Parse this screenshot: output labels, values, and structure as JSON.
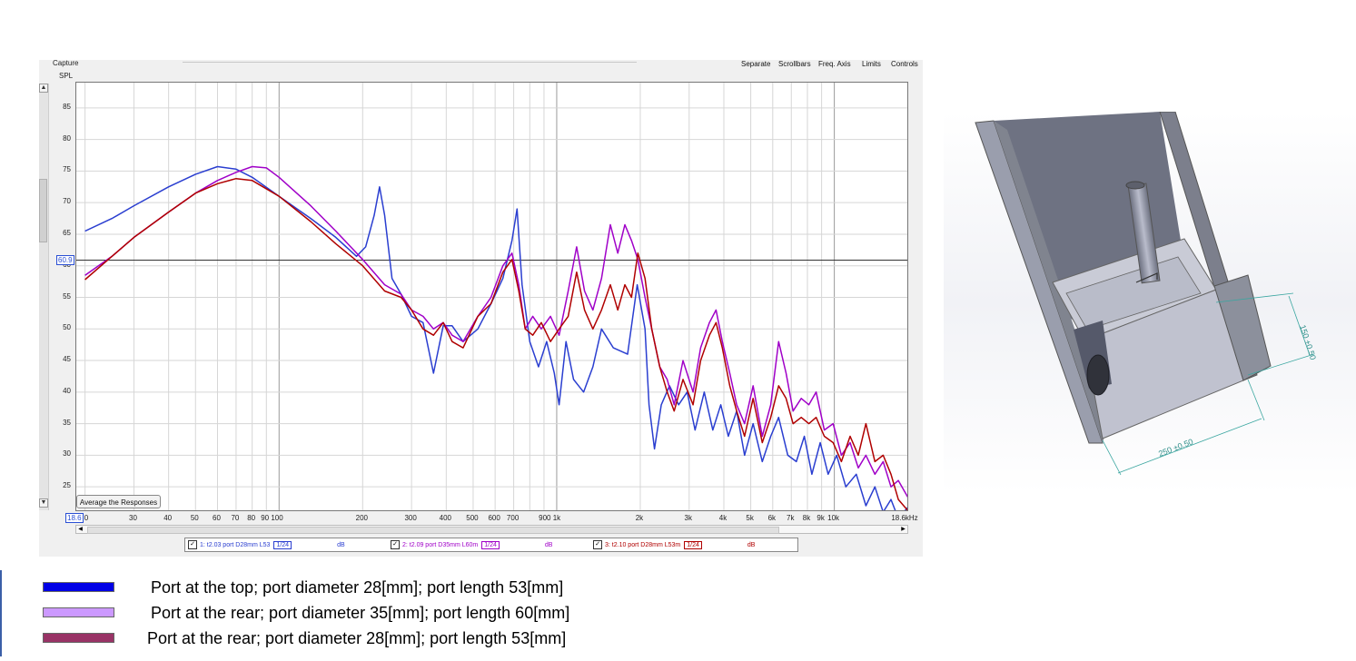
{
  "rew": {
    "capture_label": "Capture",
    "spl_label": "SPL",
    "menu": [
      "Separate",
      "Scrollbars",
      "Freq. Axis",
      "Limits",
      "Controls"
    ],
    "cursor_value": "60.9",
    "start_freq_box": "18.6",
    "x_end_label": "18.6kHz",
    "average_button": "Average the Responses",
    "scroll_up_glyph": "▲",
    "scroll_down_glyph": "▼",
    "scroll_left_glyph": "◀",
    "scroll_right_glyph": "▶",
    "traces": [
      {
        "check": "✓",
        "name": "1: t2.03 port D28mm L53",
        "smoothing": "1/24",
        "unit": "dB",
        "color": "#2a3ed0"
      },
      {
        "check": "✓",
        "name": "2: t2.09 port D35mm L60m",
        "smoothing": "1/24",
        "unit": "dB",
        "color": "#a000c8"
      },
      {
        "check": "✓",
        "name": "3: t2.10 port D28mm L53m",
        "smoothing": "1/24",
        "unit": "dB",
        "color": "#b00000"
      }
    ]
  },
  "legend": [
    {
      "label": "Port at the top; port diameter 28[mm]; port length 53[mm]",
      "color": "#0000e6"
    },
    {
      "label": "Port at the rear; port diameter 35[mm]; port length 60[mm]",
      "color": "#cc99ff"
    },
    {
      "label": "Port at the rear; port diameter 28[mm]; port length 53[mm]",
      "color": "#993366"
    }
  ],
  "cad": {
    "dim_height": "150 ±0.50",
    "dim_width": "250 ±0.50"
  },
  "chart_data": {
    "type": "line",
    "title": "",
    "xlabel": "",
    "ylabel": "SPL",
    "x_scale": "log",
    "xlim": [
      18.6,
      18600
    ],
    "ylim": [
      21,
      89
    ],
    "x_tick_labels": [
      "0",
      "30",
      "40",
      "50",
      "60",
      "70",
      "80",
      "90 100",
      "200",
      "300",
      "400",
      "500",
      "600",
      "700",
      "900 1k",
      "2k",
      "3k",
      "4k",
      "5k",
      "6k",
      "7k",
      "8k",
      "9k",
      "10k"
    ],
    "x_tick_values": [
      18.6,
      30,
      40,
      50,
      60,
      70,
      80,
      95,
      200,
      300,
      400,
      500,
      600,
      700,
      950,
      2000,
      3000,
      4000,
      5000,
      6000,
      7000,
      8000,
      9000,
      10000
    ],
    "y_ticks": [
      25,
      30,
      35,
      40,
      45,
      50,
      55,
      60,
      65,
      70,
      75,
      80,
      85
    ],
    "cursor_line_y": 60.9,
    "grid": true,
    "series": [
      {
        "name": "1: t2.03 port D28mm L53",
        "color": "#2a3ed0",
        "points": [
          [
            20,
            65.5
          ],
          [
            25,
            67.5
          ],
          [
            30,
            69.5
          ],
          [
            40,
            72.5
          ],
          [
            50,
            74.5
          ],
          [
            60,
            75.7
          ],
          [
            70,
            75.3
          ],
          [
            80,
            74
          ],
          [
            100,
            71
          ],
          [
            130,
            67.5
          ],
          [
            160,
            64.5
          ],
          [
            190,
            61.5
          ],
          [
            205,
            63
          ],
          [
            220,
            68
          ],
          [
            230,
            72.5
          ],
          [
            240,
            68
          ],
          [
            255,
            58
          ],
          [
            275,
            55.5
          ],
          [
            300,
            52
          ],
          [
            330,
            51
          ],
          [
            360,
            43
          ],
          [
            390,
            50.5
          ],
          [
            420,
            50.5
          ],
          [
            460,
            48
          ],
          [
            520,
            50
          ],
          [
            580,
            54
          ],
          [
            640,
            58
          ],
          [
            690,
            64
          ],
          [
            720,
            69
          ],
          [
            750,
            57
          ],
          [
            800,
            48
          ],
          [
            860,
            44
          ],
          [
            920,
            48
          ],
          [
            980,
            43
          ],
          [
            1020,
            38
          ],
          [
            1080,
            48
          ],
          [
            1150,
            42
          ],
          [
            1250,
            40
          ],
          [
            1350,
            44
          ],
          [
            1450,
            50
          ],
          [
            1600,
            47
          ],
          [
            1800,
            46
          ],
          [
            1950,
            57
          ],
          [
            2080,
            50
          ],
          [
            2150,
            38
          ],
          [
            2250,
            31
          ],
          [
            2380,
            38
          ],
          [
            2550,
            41
          ],
          [
            2750,
            38
          ],
          [
            2950,
            40
          ],
          [
            3150,
            34
          ],
          [
            3400,
            40
          ],
          [
            3650,
            34
          ],
          [
            3900,
            38
          ],
          [
            4150,
            33
          ],
          [
            4450,
            37
          ],
          [
            4750,
            30
          ],
          [
            5100,
            35
          ],
          [
            5500,
            29
          ],
          [
            5900,
            33
          ],
          [
            6300,
            36
          ],
          [
            6800,
            30
          ],
          [
            7300,
            29
          ],
          [
            7800,
            33
          ],
          [
            8300,
            27
          ],
          [
            8900,
            32
          ],
          [
            9500,
            27
          ],
          [
            10200,
            30
          ],
          [
            11000,
            25
          ],
          [
            12000,
            27
          ],
          [
            13000,
            22
          ],
          [
            14000,
            25
          ],
          [
            15000,
            21
          ],
          [
            16000,
            23
          ],
          [
            17000,
            20
          ],
          [
            18600,
            22
          ]
        ]
      },
      {
        "name": "2: t2.09 port D35mm L60m",
        "color": "#a000c8",
        "points": [
          [
            20,
            58.5
          ],
          [
            25,
            61.5
          ],
          [
            30,
            64.5
          ],
          [
            40,
            68.5
          ],
          [
            50,
            71.5
          ],
          [
            60,
            73.5
          ],
          [
            70,
            74.8
          ],
          [
            80,
            75.7
          ],
          [
            90,
            75.5
          ],
          [
            100,
            74
          ],
          [
            130,
            69.5
          ],
          [
            160,
            65.5
          ],
          [
            200,
            61
          ],
          [
            240,
            57
          ],
          [
            275,
            55.5
          ],
          [
            300,
            53
          ],
          [
            330,
            52
          ],
          [
            360,
            50
          ],
          [
            390,
            51
          ],
          [
            420,
            49
          ],
          [
            460,
            48
          ],
          [
            520,
            52
          ],
          [
            580,
            55
          ],
          [
            640,
            60
          ],
          [
            690,
            62
          ],
          [
            730,
            57
          ],
          [
            770,
            50
          ],
          [
            820,
            52
          ],
          [
            880,
            50
          ],
          [
            950,
            52
          ],
          [
            1020,
            49
          ],
          [
            1100,
            56
          ],
          [
            1180,
            63
          ],
          [
            1260,
            56
          ],
          [
            1350,
            53
          ],
          [
            1450,
            58
          ],
          [
            1560,
            66.5
          ],
          [
            1660,
            62
          ],
          [
            1760,
            66.5
          ],
          [
            1860,
            64
          ],
          [
            1960,
            61
          ],
          [
            2080,
            55
          ],
          [
            2200,
            50
          ],
          [
            2350,
            44
          ],
          [
            2500,
            42
          ],
          [
            2650,
            38
          ],
          [
            2850,
            45
          ],
          [
            3100,
            40
          ],
          [
            3300,
            47
          ],
          [
            3550,
            51
          ],
          [
            3750,
            53
          ],
          [
            3950,
            48
          ],
          [
            4200,
            43
          ],
          [
            4450,
            38
          ],
          [
            4750,
            35
          ],
          [
            5100,
            41
          ],
          [
            5500,
            33
          ],
          [
            5900,
            38
          ],
          [
            6300,
            48
          ],
          [
            6700,
            43
          ],
          [
            7100,
            37
          ],
          [
            7600,
            39
          ],
          [
            8100,
            38
          ],
          [
            8600,
            40
          ],
          [
            9200,
            34
          ],
          [
            9900,
            35
          ],
          [
            10600,
            30
          ],
          [
            11400,
            32
          ],
          [
            12200,
            28
          ],
          [
            13000,
            30
          ],
          [
            14000,
            27
          ],
          [
            15000,
            29
          ],
          [
            16000,
            25
          ],
          [
            17000,
            26
          ],
          [
            18600,
            23
          ]
        ]
      },
      {
        "name": "3: t2.10 port D28mm L53m",
        "color": "#b00000",
        "points": [
          [
            20,
            57.8
          ],
          [
            25,
            61.5
          ],
          [
            30,
            64.5
          ],
          [
            40,
            68.5
          ],
          [
            50,
            71.5
          ],
          [
            60,
            73
          ],
          [
            70,
            73.8
          ],
          [
            80,
            73.5
          ],
          [
            100,
            71
          ],
          [
            130,
            67
          ],
          [
            160,
            63.5
          ],
          [
            200,
            60
          ],
          [
            240,
            56
          ],
          [
            275,
            55
          ],
          [
            300,
            53
          ],
          [
            330,
            50
          ],
          [
            360,
            49
          ],
          [
            390,
            51
          ],
          [
            420,
            48
          ],
          [
            460,
            47
          ],
          [
            520,
            52
          ],
          [
            580,
            54
          ],
          [
            640,
            59
          ],
          [
            690,
            61
          ],
          [
            730,
            56
          ],
          [
            770,
            50
          ],
          [
            820,
            49
          ],
          [
            880,
            51
          ],
          [
            950,
            48
          ],
          [
            1020,
            50
          ],
          [
            1100,
            52
          ],
          [
            1180,
            59
          ],
          [
            1260,
            53
          ],
          [
            1350,
            50
          ],
          [
            1450,
            53
          ],
          [
            1560,
            57
          ],
          [
            1660,
            53
          ],
          [
            1760,
            57
          ],
          [
            1860,
            55
          ],
          [
            1960,
            62
          ],
          [
            2080,
            58
          ],
          [
            2200,
            50
          ],
          [
            2350,
            44
          ],
          [
            2500,
            40
          ],
          [
            2650,
            37
          ],
          [
            2850,
            42
          ],
          [
            3100,
            38
          ],
          [
            3300,
            45
          ],
          [
            3550,
            49
          ],
          [
            3750,
            51
          ],
          [
            3950,
            47
          ],
          [
            4200,
            41
          ],
          [
            4450,
            37
          ],
          [
            4750,
            33
          ],
          [
            5100,
            39
          ],
          [
            5500,
            32
          ],
          [
            5900,
            36
          ],
          [
            6300,
            41
          ],
          [
            6700,
            39
          ],
          [
            7100,
            35
          ],
          [
            7600,
            36
          ],
          [
            8100,
            35
          ],
          [
            8600,
            36
          ],
          [
            9200,
            33
          ],
          [
            9900,
            32
          ],
          [
            10600,
            29
          ],
          [
            11400,
            33
          ],
          [
            12200,
            30
          ],
          [
            13000,
            35
          ],
          [
            14000,
            29
          ],
          [
            15000,
            30
          ],
          [
            16000,
            27
          ],
          [
            17000,
            23
          ],
          [
            18600,
            21
          ]
        ]
      }
    ]
  }
}
